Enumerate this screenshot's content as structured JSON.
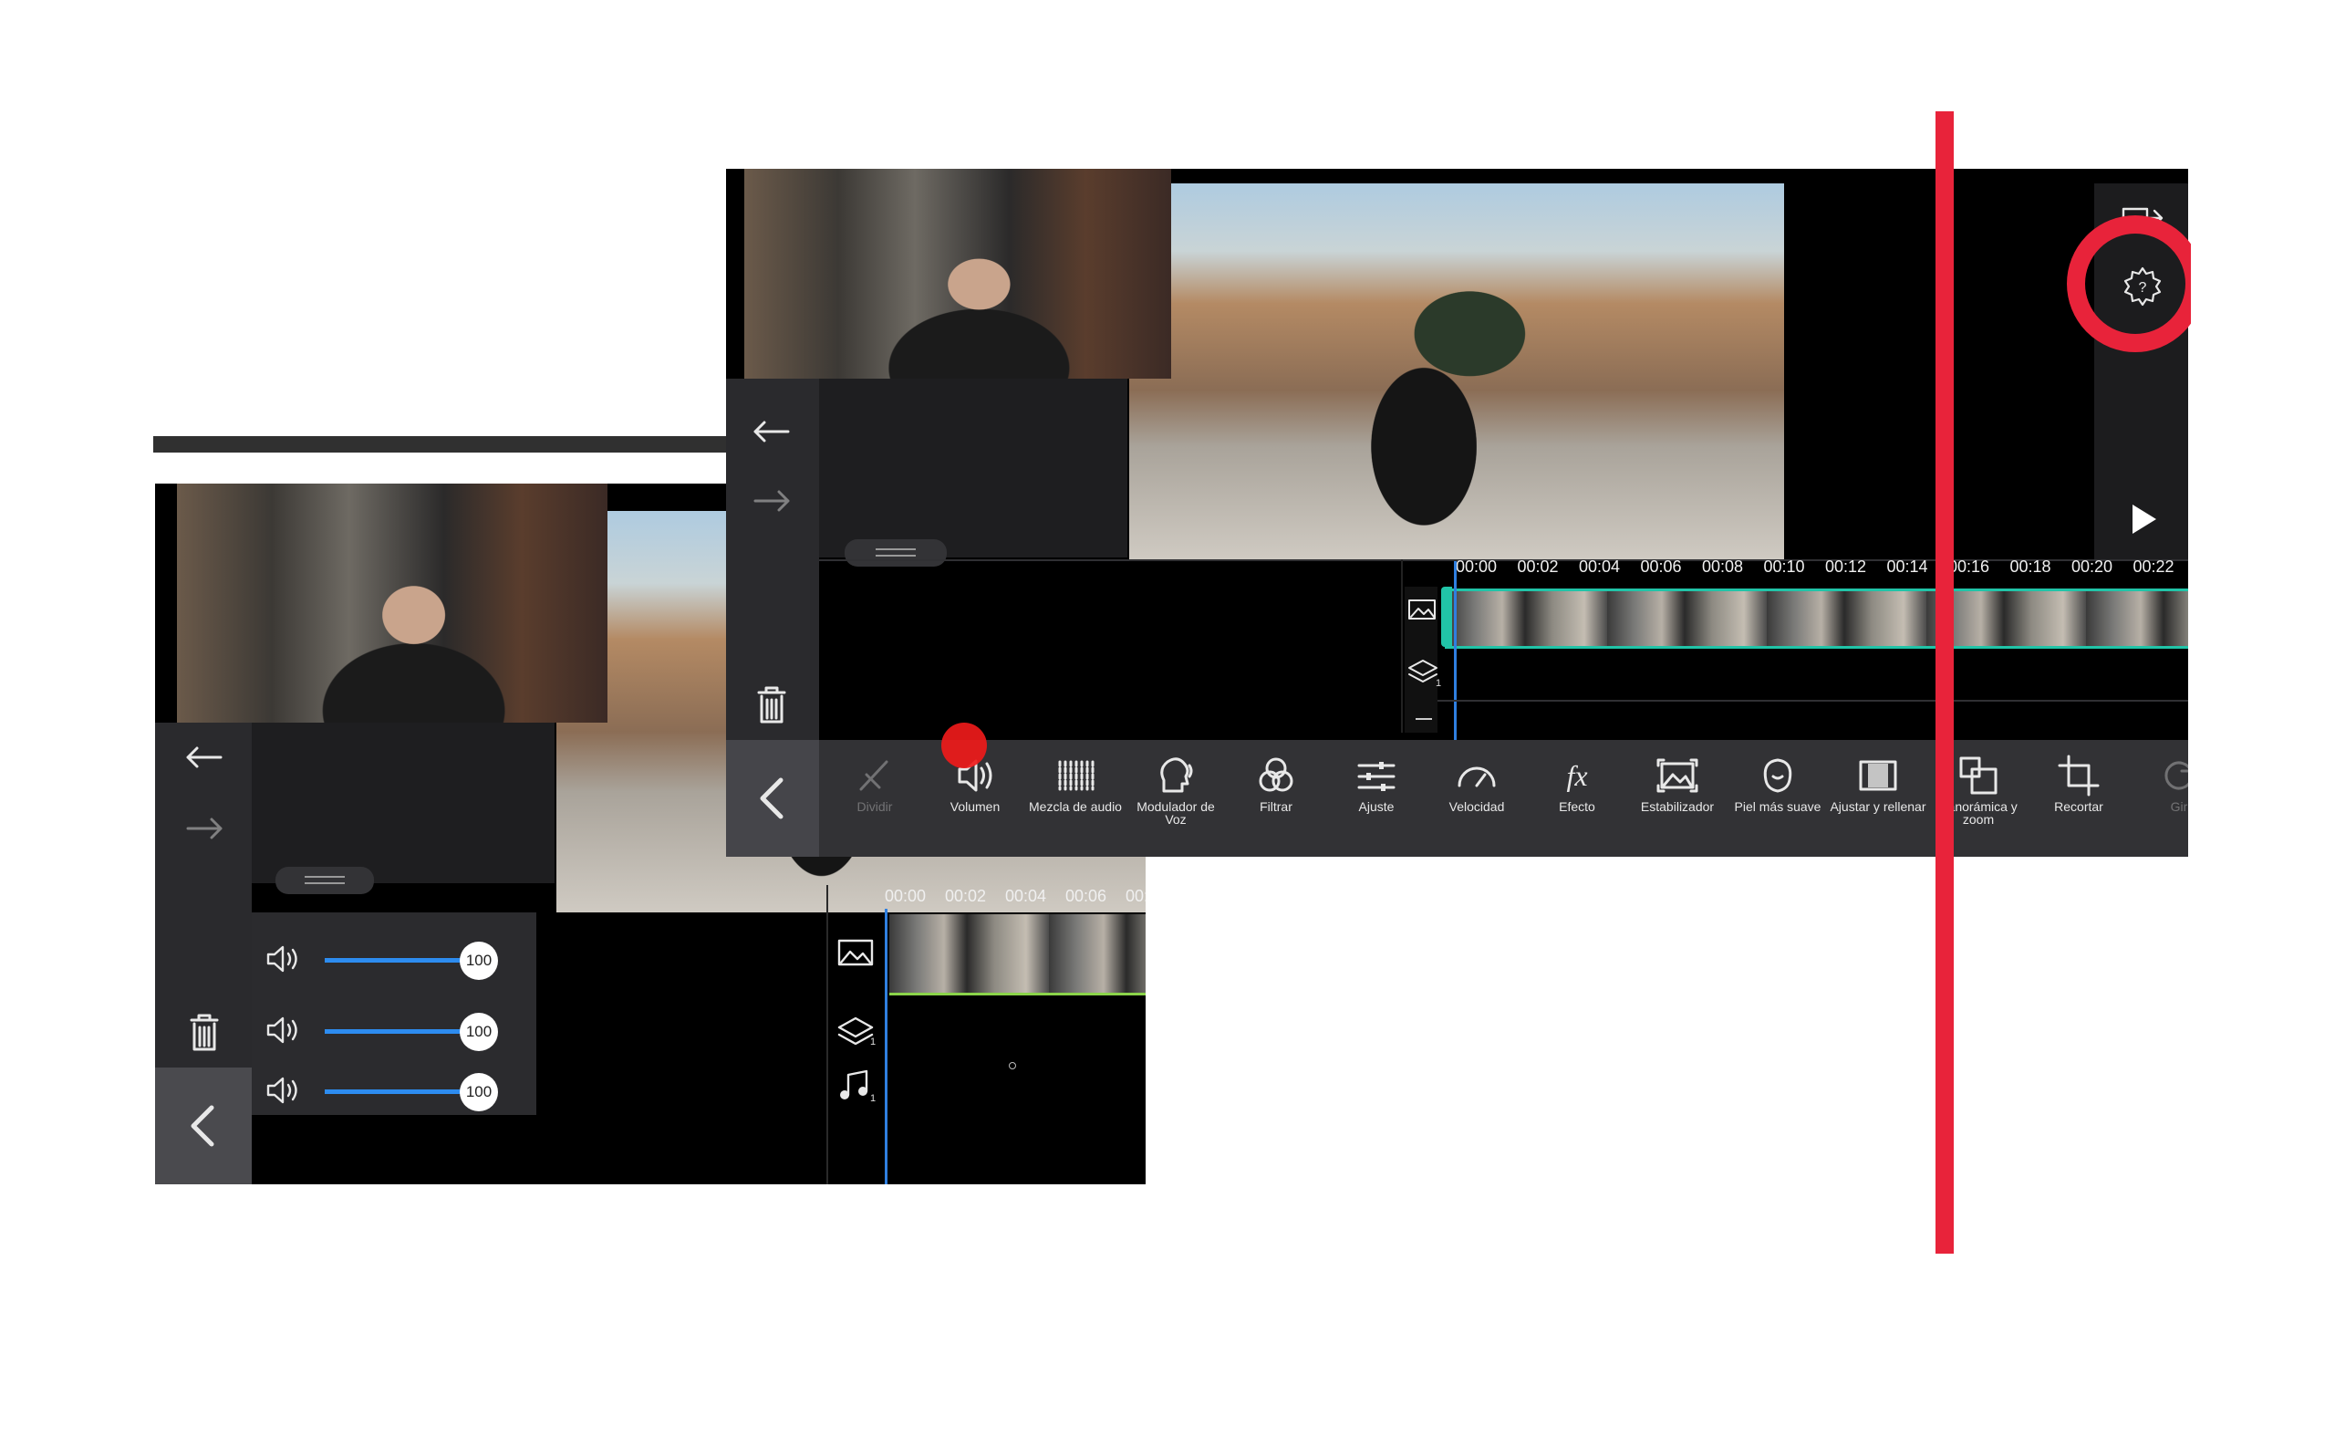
{
  "back_editor": {
    "volume_rows": [
      {
        "value": "100",
        "fill": 1.0
      },
      {
        "value": "100",
        "fill": 1.0
      },
      {
        "value": "100",
        "fill": 1.0
      }
    ],
    "timeline_ticks": [
      "00:00",
      "00:02",
      "00:04",
      "00:06",
      "00:0"
    ],
    "track_layer_count": "1",
    "track_audio_count": "1"
  },
  "front_editor": {
    "timeline_ticks": [
      "00:00",
      "00:02",
      "00:04",
      "00:06",
      "00:08",
      "00:10",
      "00:12",
      "00:14",
      "00:16",
      "00:18",
      "00:20",
      "00:22"
    ],
    "track_layer_count": "1",
    "tools": [
      {
        "label": "Dividir",
        "icon": "split-icon",
        "enabled": false
      },
      {
        "label": "Volumen",
        "icon": "volume-icon",
        "enabled": true
      },
      {
        "label": "Mezcla de audio",
        "icon": "audio-mix-icon",
        "enabled": true
      },
      {
        "label": "Modulador de Voz",
        "icon": "voice-changer-icon",
        "enabled": true
      },
      {
        "label": "Filtrar",
        "icon": "filter-icon",
        "enabled": true
      },
      {
        "label": "Ajuste",
        "icon": "adjust-icon",
        "enabled": true
      },
      {
        "label": "Velocidad",
        "icon": "speed-icon",
        "enabled": true
      },
      {
        "label": "Efecto",
        "icon": "fx-icon",
        "enabled": true
      },
      {
        "label": "Estabilizador",
        "icon": "stabilizer-icon",
        "enabled": true
      },
      {
        "label": "Piel más suave",
        "icon": "skin-smooth-icon",
        "enabled": true
      },
      {
        "label": "Ajustar y rellenar",
        "icon": "fit-fill-icon",
        "enabled": true
      },
      {
        "label": "Panorámica y zoom",
        "icon": "pan-zoom-icon",
        "enabled": true
      },
      {
        "label": "Recortar",
        "icon": "crop-icon",
        "enabled": true
      },
      {
        "label": "Gir",
        "icon": "rotate-icon",
        "enabled": false
      }
    ],
    "fx_glyph": "fx"
  },
  "colors": {
    "accent_red": "#e8233a",
    "slider_blue": "#2d8cf0",
    "clip_teal": "#21c4a8",
    "playhead_blue": "#2f7fe0"
  }
}
